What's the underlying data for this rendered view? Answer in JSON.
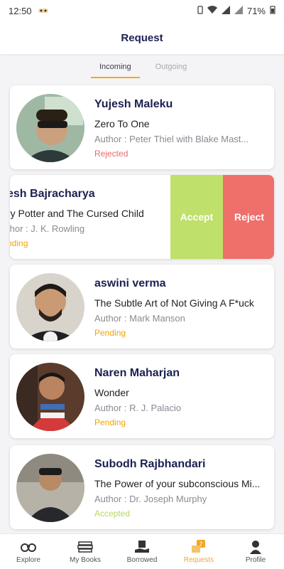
{
  "status_bar": {
    "time": "12:50",
    "battery": "71%"
  },
  "header": {
    "title": "Request"
  },
  "tabs": [
    {
      "label": "Incoming"
    },
    {
      "label": "Outgoing"
    }
  ],
  "requests": [
    {
      "name": "Yujesh Maleku",
      "book": "Zero To One",
      "author": "Author : Peter Thiel with Blake Mast...",
      "status": "Rejected"
    },
    {
      "name": "esh Bajracharya",
      "book": "ry Potter and The Cursed Child",
      "author": "thor : J. K. Rowling",
      "status": "nding"
    },
    {
      "name": "aswini verma",
      "book": "The Subtle Art of Not Giving A F*uck",
      "author": "Author : Mark Manson",
      "status": "Pending"
    },
    {
      "name": "Naren Maharjan",
      "book": "Wonder",
      "author": "Author : R. J. Palacio",
      "status": "Pending"
    },
    {
      "name": "Subodh Rajbhandari",
      "book": "The Power of your subconscious Mi...",
      "author": "Author : Dr. Joseph Murphy",
      "status": "Accepted"
    }
  ],
  "swipe_actions": {
    "accept": "Accept",
    "reject": "Reject"
  },
  "nav": [
    {
      "label": "Explore",
      "icon": "binoculars-icon"
    },
    {
      "label": "My Books",
      "icon": "books-icon"
    },
    {
      "label": "Borrowed",
      "icon": "borrow-hand-icon"
    },
    {
      "label": "Requests",
      "icon": "request-icon"
    },
    {
      "label": "Profile",
      "icon": "person-icon"
    }
  ],
  "colors": {
    "accent": "#f5a623",
    "title": "#1b2150",
    "accept": "#bfe06b",
    "reject": "#ef6f6a"
  }
}
